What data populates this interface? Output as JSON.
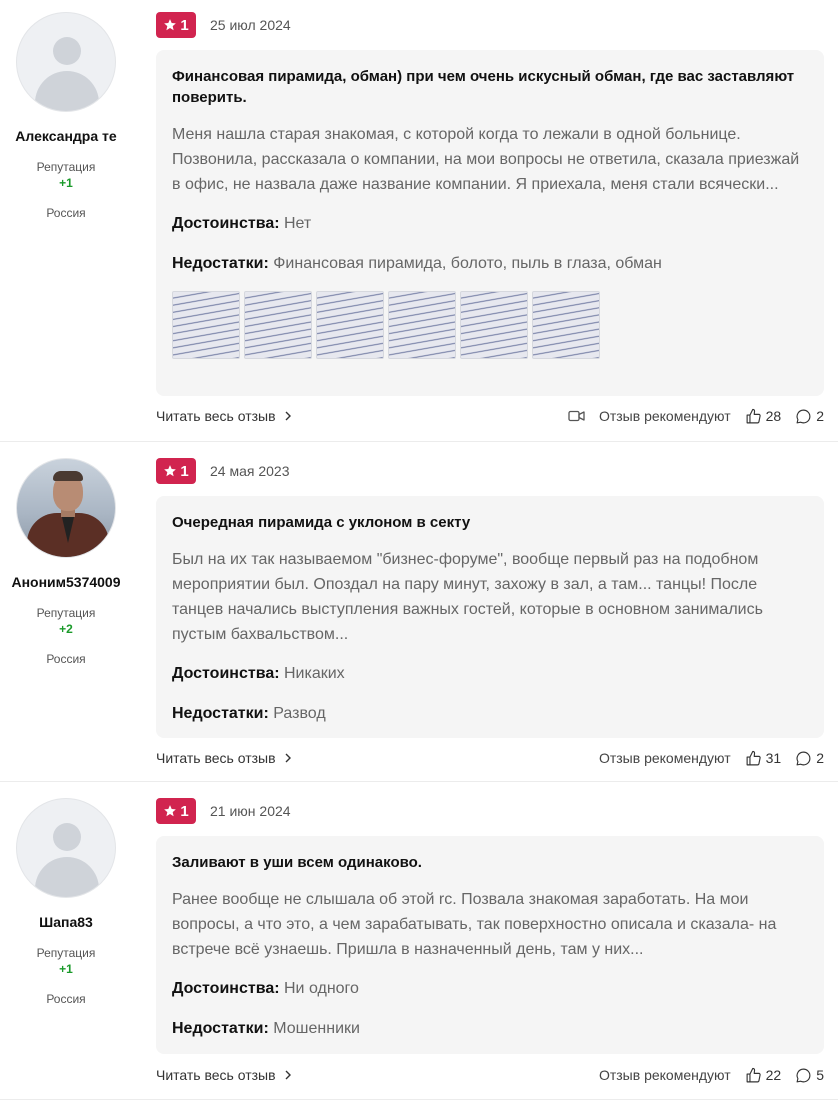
{
  "reviews": [
    {
      "author": "Александра те",
      "reputation_label": "Репутация",
      "reputation_value": "+1",
      "country": "Россия",
      "avatar": "default-avatar-icon",
      "rating": "1",
      "date": "25 июл 2024",
      "title": "Финансовая пирамида, обман) при чем очень искусный обман, где вас заставляют поверить.",
      "text": "Меня нашла старая знакомая, с которой когда то лежали в одной больнице. Позвонила, рассказала о компании, на мои вопросы не ответила, сказала приезжай в офис, не назвала даже название компании. Я приехала, меня стали всячески...",
      "pros_label": "Достоинства:",
      "pros": "Нет",
      "cons_label": "Недостатки:",
      "cons": "Финансовая пирамида, болото, пыль в глаза, обман",
      "read_more": "Читать весь отзыв",
      "recommend": "Отзыв рекомендуют",
      "likes": "28",
      "comments": "2"
    },
    {
      "author": "Аноним5374009",
      "reputation_label": "Репутация",
      "reputation_value": "+2",
      "country": "Россия",
      "avatar": "user-photo",
      "rating": "1",
      "date": "24 мая 2023",
      "title": "Очередная пирамида с уклоном в секту",
      "text": "Был на их так называемом \"бизнес-форуме\", вообще первый раз на подобном мероприятии был. Опоздал на пару минут, захожу в зал, а там... танцы! После танцев начались выступления важных гостей, которые в основном занимались пустым бахвальством...",
      "pros_label": "Достоинства:",
      "pros": "Никаких",
      "cons_label": "Недостатки:",
      "cons": "Развод",
      "read_more": "Читать весь отзыв",
      "recommend": "Отзыв рекомендуют",
      "likes": "31",
      "comments": "2"
    },
    {
      "author": "Шапа83",
      "reputation_label": "Репутация",
      "reputation_value": "+1",
      "country": "Россия",
      "avatar": "default-avatar-icon",
      "rating": "1",
      "date": "21 июн 2024",
      "title": "Заливают в уши всем одинаково.",
      "text": "Ранее вообще не слышала об этой rc. Позвала знакомая заработать. На мои вопросы, а что это, а чем зарабатывать, так поверхностно описала и сказала- на встрече всё узнаешь. Пришла в назначенный день, там у них...",
      "pros_label": "Достоинства:",
      "pros": "Ни одного",
      "cons_label": "Недостатки:",
      "cons": "Мошенники",
      "read_more": "Читать весь отзыв",
      "recommend": "Отзыв рекомендуют",
      "likes": "22",
      "comments": "5"
    }
  ],
  "colors": {
    "rating_badge": "#d1244f",
    "reputation_positive": "#1a9a2a",
    "card_background": "#f5f5f5"
  },
  "icons": [
    "star-icon",
    "chevron-right-icon",
    "video-icon",
    "thumbs-up-icon",
    "comment-icon"
  ]
}
